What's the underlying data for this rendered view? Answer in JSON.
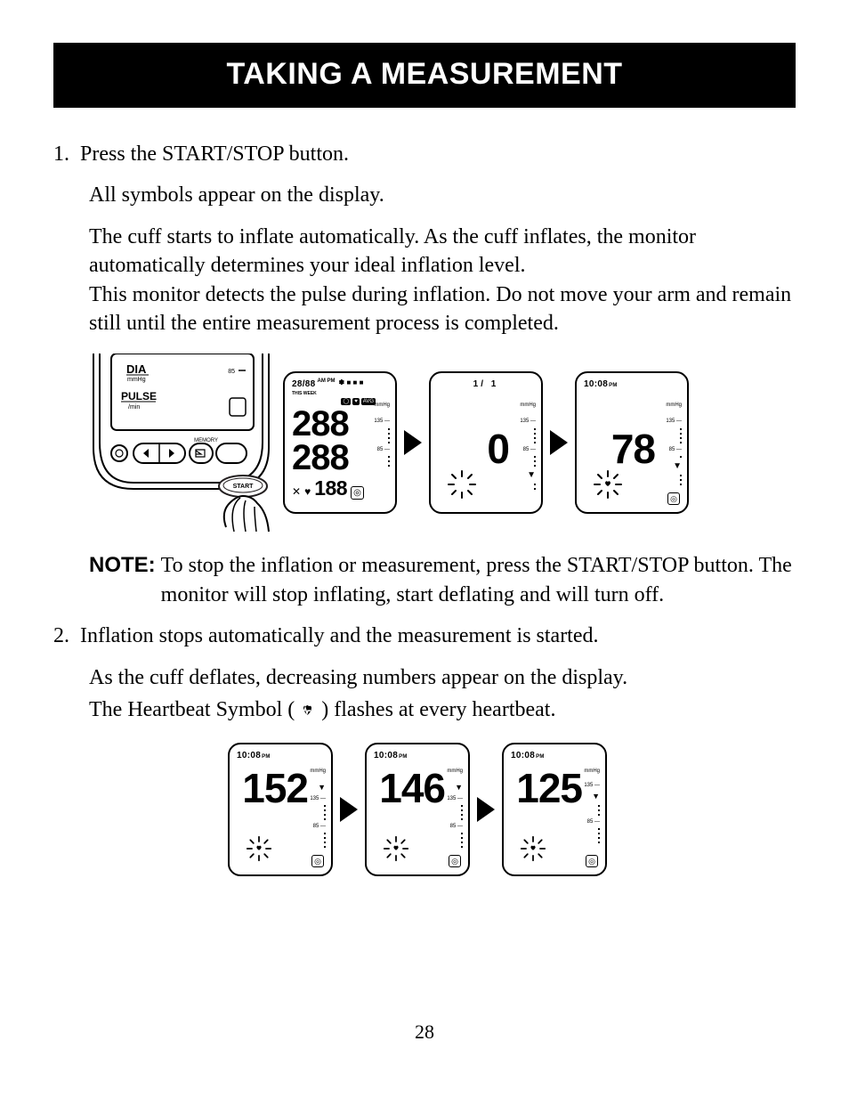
{
  "title": "TAKING A MEASUREMENT",
  "page_number": "28",
  "steps": {
    "s1_num": "1.",
    "s1_head": "Press the START/STOP button.",
    "s1_p1": "All symbols appear on the display.",
    "s1_p2": "The cuff starts to inflate automatically. As the cuff inflates, the monitor automatically determines your ideal inflation level.",
    "s1_p3": "This monitor detects the pulse during inflation. Do not move your arm and remain still until the entire measurement process is completed.",
    "s2_num": "2.",
    "s2_head": "Inflation stops automatically and the measurement is started.",
    "s2_p1": "As the cuff deflates, decreasing numbers appear on the display.",
    "s2_p2a": "The Heartbeat Symbol (",
    "s2_p2b": ") flashes at every heartbeat."
  },
  "note": {
    "label": "NOTE:",
    "body": "To stop the inflation or measurement, press the START/STOP button. The monitor will stop inflating, start deflating and will turn off."
  },
  "device": {
    "dia": "DIA",
    "mmhg": "mmHg",
    "pulse": "PULSE",
    "per_min": "/min",
    "memory": "MEMORY",
    "start": "START",
    "tick85": "85"
  },
  "row1": {
    "scr_a": {
      "top": "28/88",
      "ampm": "AM PM",
      "this_week": "THIS WEEK",
      "avg": "AVG",
      "sys": "288",
      "dia2": "288",
      "pulse_big": "188",
      "mmhg": "mmHg",
      "t135": "135",
      "t85": "85"
    },
    "scr_b": {
      "top": "1/ 1",
      "big": "0",
      "mmhg": "mmHg",
      "t135": "135",
      "t85": "85"
    },
    "scr_c": {
      "top": "10:08",
      "pm": "PM",
      "big": "78",
      "mmhg": "mmHg",
      "t135": "135",
      "t85": "85",
      "ok": "OK"
    }
  },
  "row2": {
    "time": "10:08",
    "pm": "PM",
    "mmhg": "mmHg",
    "t135": "135",
    "t85": "85",
    "ok": "OK",
    "v1": "152",
    "v2": "146",
    "v3": "125"
  }
}
